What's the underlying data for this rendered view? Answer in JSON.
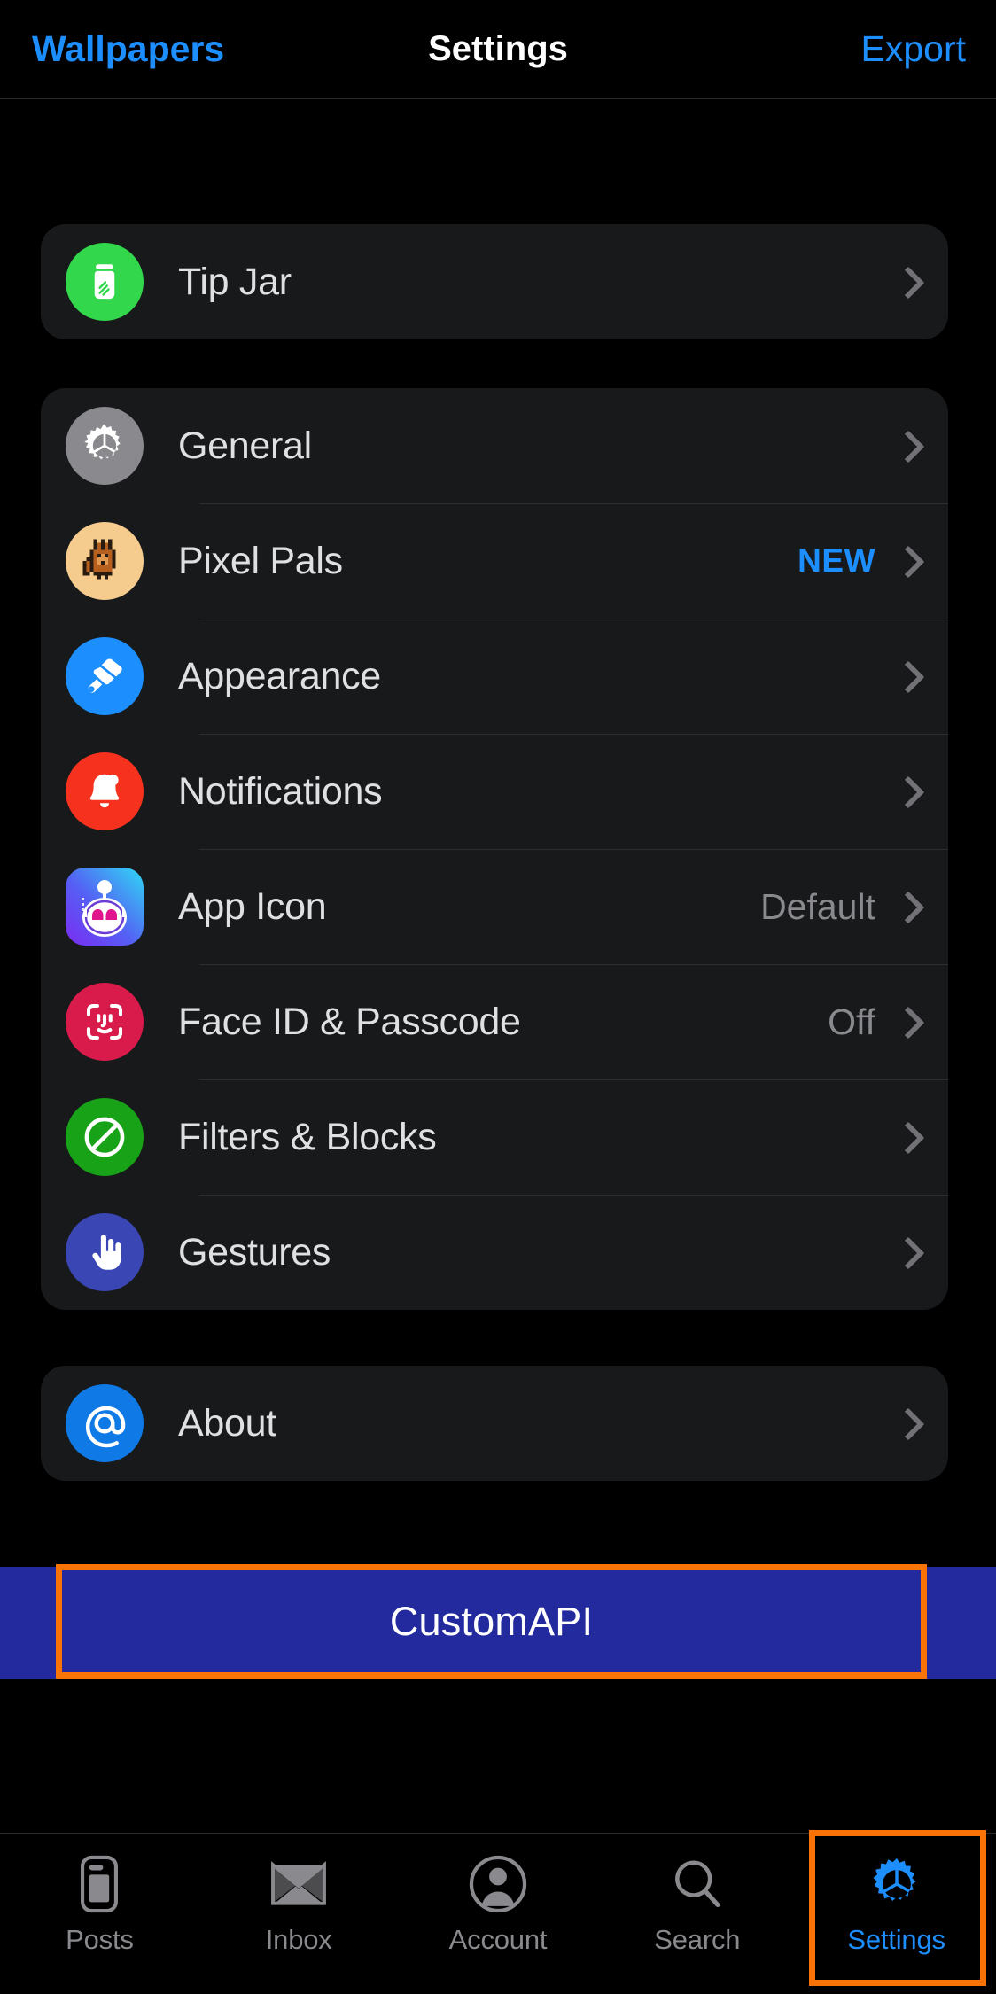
{
  "navbar": {
    "left_label": "Wallpapers",
    "title": "Settings",
    "right_label": "Export",
    "accent_color": "#1d8efd"
  },
  "sections": [
    {
      "id": "tip-jar-section",
      "rows": [
        {
          "label": "Tip Jar",
          "icon": "jar-icon",
          "icon_bg": "#32d74b",
          "value": "",
          "badge": "",
          "chevron": true
        }
      ]
    },
    {
      "id": "main-settings-section",
      "rows": [
        {
          "label": "General",
          "icon": "gear-icon",
          "icon_bg": "#8a8a8e",
          "value": "",
          "badge": "",
          "chevron": true
        },
        {
          "label": "Pixel Pals",
          "icon": "pixel-pet-icon",
          "icon_bg": "#f6cb8e",
          "value": "",
          "badge": "NEW",
          "chevron": true
        },
        {
          "label": "Appearance",
          "icon": "paintbrush-icon",
          "icon_bg": "#1d8efd",
          "value": "",
          "badge": "",
          "chevron": true
        },
        {
          "label": "Notifications",
          "icon": "bell-icon",
          "icon_bg": "#f6321f",
          "value": "",
          "badge": "",
          "chevron": true
        },
        {
          "label": "App Icon",
          "icon": "robot-app-icon",
          "icon_bg": "#5b5cf6",
          "value": "Default",
          "badge": "",
          "chevron": true
        },
        {
          "label": "Face ID & Passcode",
          "icon": "faceid-icon",
          "icon_bg": "#d81b4a",
          "value": "Off",
          "badge": "",
          "chevron": true
        },
        {
          "label": "Filters & Blocks",
          "icon": "no-entry-icon",
          "icon_bg": "#18a217",
          "value": "",
          "badge": "",
          "chevron": true
        },
        {
          "label": "Gestures",
          "icon": "hand-pointer-icon",
          "icon_bg": "#3a46b4",
          "value": "",
          "badge": "",
          "chevron": true
        }
      ]
    },
    {
      "id": "about-section",
      "rows": [
        {
          "label": "About",
          "icon": "at-sign-icon",
          "icon_bg": "#0f7ae5",
          "value": "",
          "badge": "",
          "chevron": true
        }
      ]
    }
  ],
  "banner": {
    "label": "CustomAPI",
    "background_color": "#232a9e",
    "highlight_color": "#f97306"
  },
  "tabbar": {
    "highlight_color": "#f97306",
    "tabs": [
      {
        "label": "Posts",
        "icon": "posts-card-icon",
        "active": false
      },
      {
        "label": "Inbox",
        "icon": "envelope-icon",
        "active": false
      },
      {
        "label": "Account",
        "icon": "person-circle-icon",
        "active": false
      },
      {
        "label": "Search",
        "icon": "magnifier-icon",
        "active": false
      },
      {
        "label": "Settings",
        "icon": "gear-icon",
        "active": true
      }
    ]
  }
}
